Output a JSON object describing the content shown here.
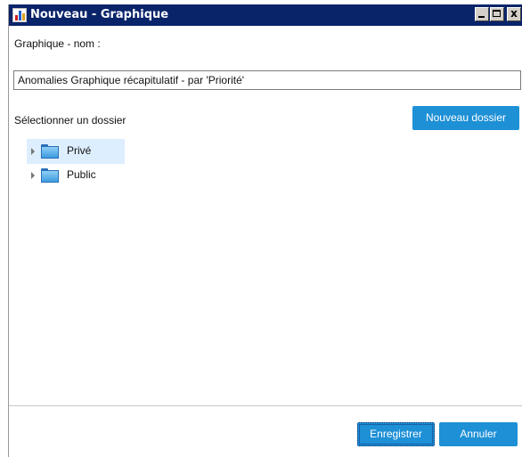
{
  "window": {
    "title": "Nouveau - Graphique",
    "controls": {
      "minimize": "minimize",
      "maximize": "maximize",
      "close": "x"
    }
  },
  "form": {
    "name_label": "Graphique - nom :",
    "name_value": "Anomalies Graphique récapitulatif - par 'Priorité'",
    "folder_label": "Sélectionner un dossier",
    "new_folder_button": "Nouveau dossier"
  },
  "tree": {
    "items": [
      {
        "label": "Privé",
        "icon": "folder-icon",
        "selected": true
      },
      {
        "label": "Public",
        "icon": "folder-icon",
        "selected": false
      }
    ]
  },
  "footer": {
    "save_button": "Enregistrer",
    "cancel_button": "Annuler"
  },
  "colors": {
    "titlebar": "#0a246a",
    "accent_button": "#1e90d6",
    "selection": "#ddeeff"
  }
}
